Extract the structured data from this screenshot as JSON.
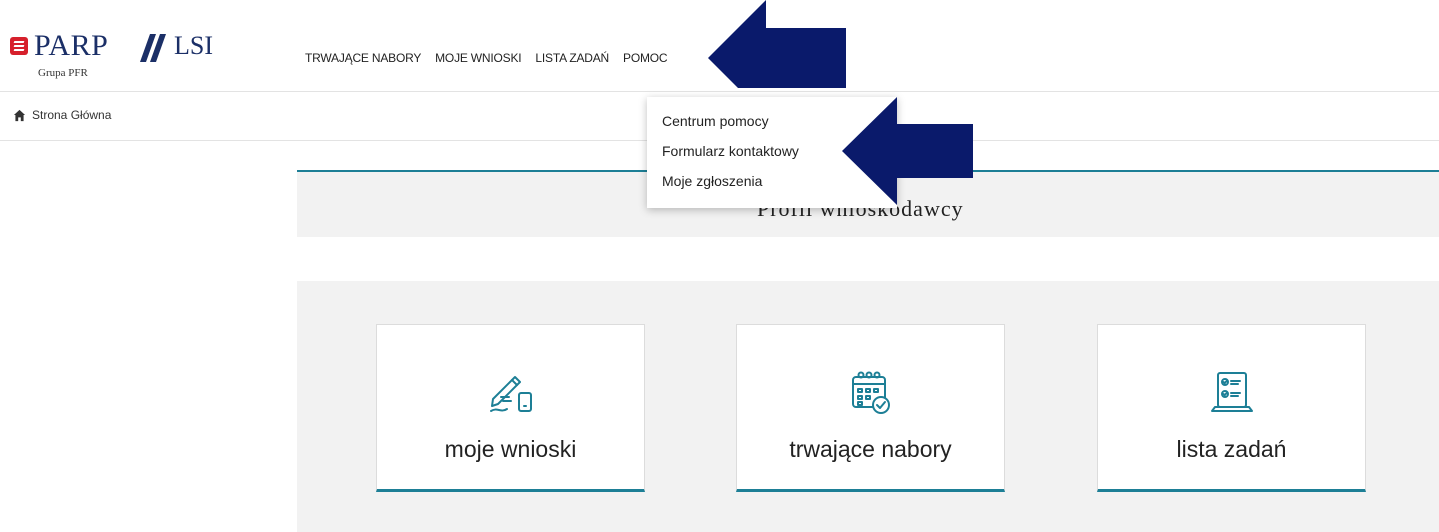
{
  "logo": {
    "brand": "PARP",
    "product": "LSI",
    "group": "Grupa PFR"
  },
  "nav": {
    "items": [
      {
        "label": "TRWAJĄCE NABORY"
      },
      {
        "label": "MOJE WNIOSKI"
      },
      {
        "label": "LISTA ZADAŃ"
      },
      {
        "label": "POMOC"
      }
    ]
  },
  "breadcrumb": {
    "home_label": "Strona Główna",
    "icon": "home-icon"
  },
  "help_menu": {
    "items": [
      {
        "label": "Centrum pomocy"
      },
      {
        "label": "Formularz kontaktowy"
      },
      {
        "label": "Moje zgłoszenia"
      }
    ]
  },
  "profile": {
    "title": "Profil wnioskodawcy"
  },
  "tiles": [
    {
      "label": "moje wnioski",
      "icon": "signing-icon"
    },
    {
      "label": "trwające nabory",
      "icon": "calendar-check-icon"
    },
    {
      "label": "lista zadań",
      "icon": "checklist-laptop-icon"
    }
  ],
  "colors": {
    "brand_navy": "#1b2f67",
    "brand_red": "#d6202c",
    "accent_teal": "#1d7f96",
    "arrow_navy": "#0a1a6b",
    "band_gray": "#f2f2f2"
  },
  "annotations": [
    "arrow-pointing-left-icon",
    "arrow-pointing-left-icon"
  ]
}
